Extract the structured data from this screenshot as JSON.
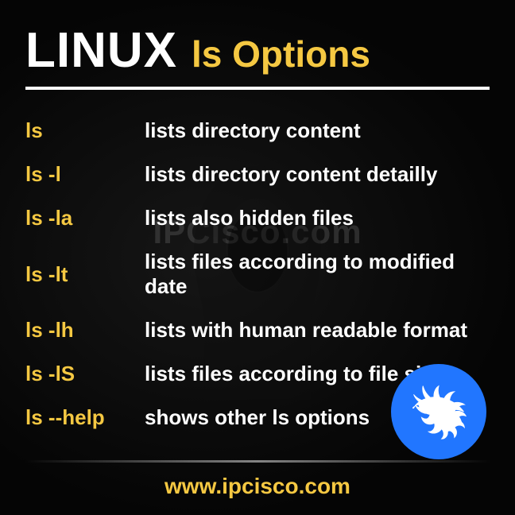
{
  "header": {
    "title_main": "LINUX",
    "title_sub": "ls Options"
  },
  "commands": [
    {
      "cmd": "ls",
      "desc": "lists directory content"
    },
    {
      "cmd": "ls -l",
      "desc": "lists directory content detailly"
    },
    {
      "cmd": "ls -la",
      "desc": "lists also hidden files"
    },
    {
      "cmd": "ls -lt",
      "desc": "lists files according to modified date"
    },
    {
      "cmd": "ls -lh",
      "desc": "lists with human readable format"
    },
    {
      "cmd": "ls -lS",
      "desc": "lists files according to file size"
    },
    {
      "cmd": "ls --help",
      "desc": "shows other ls options"
    }
  ],
  "footer": {
    "url": "www.ipcisco.com"
  },
  "watermark": "IPCisco.com",
  "logo": "kali-dragon-icon"
}
